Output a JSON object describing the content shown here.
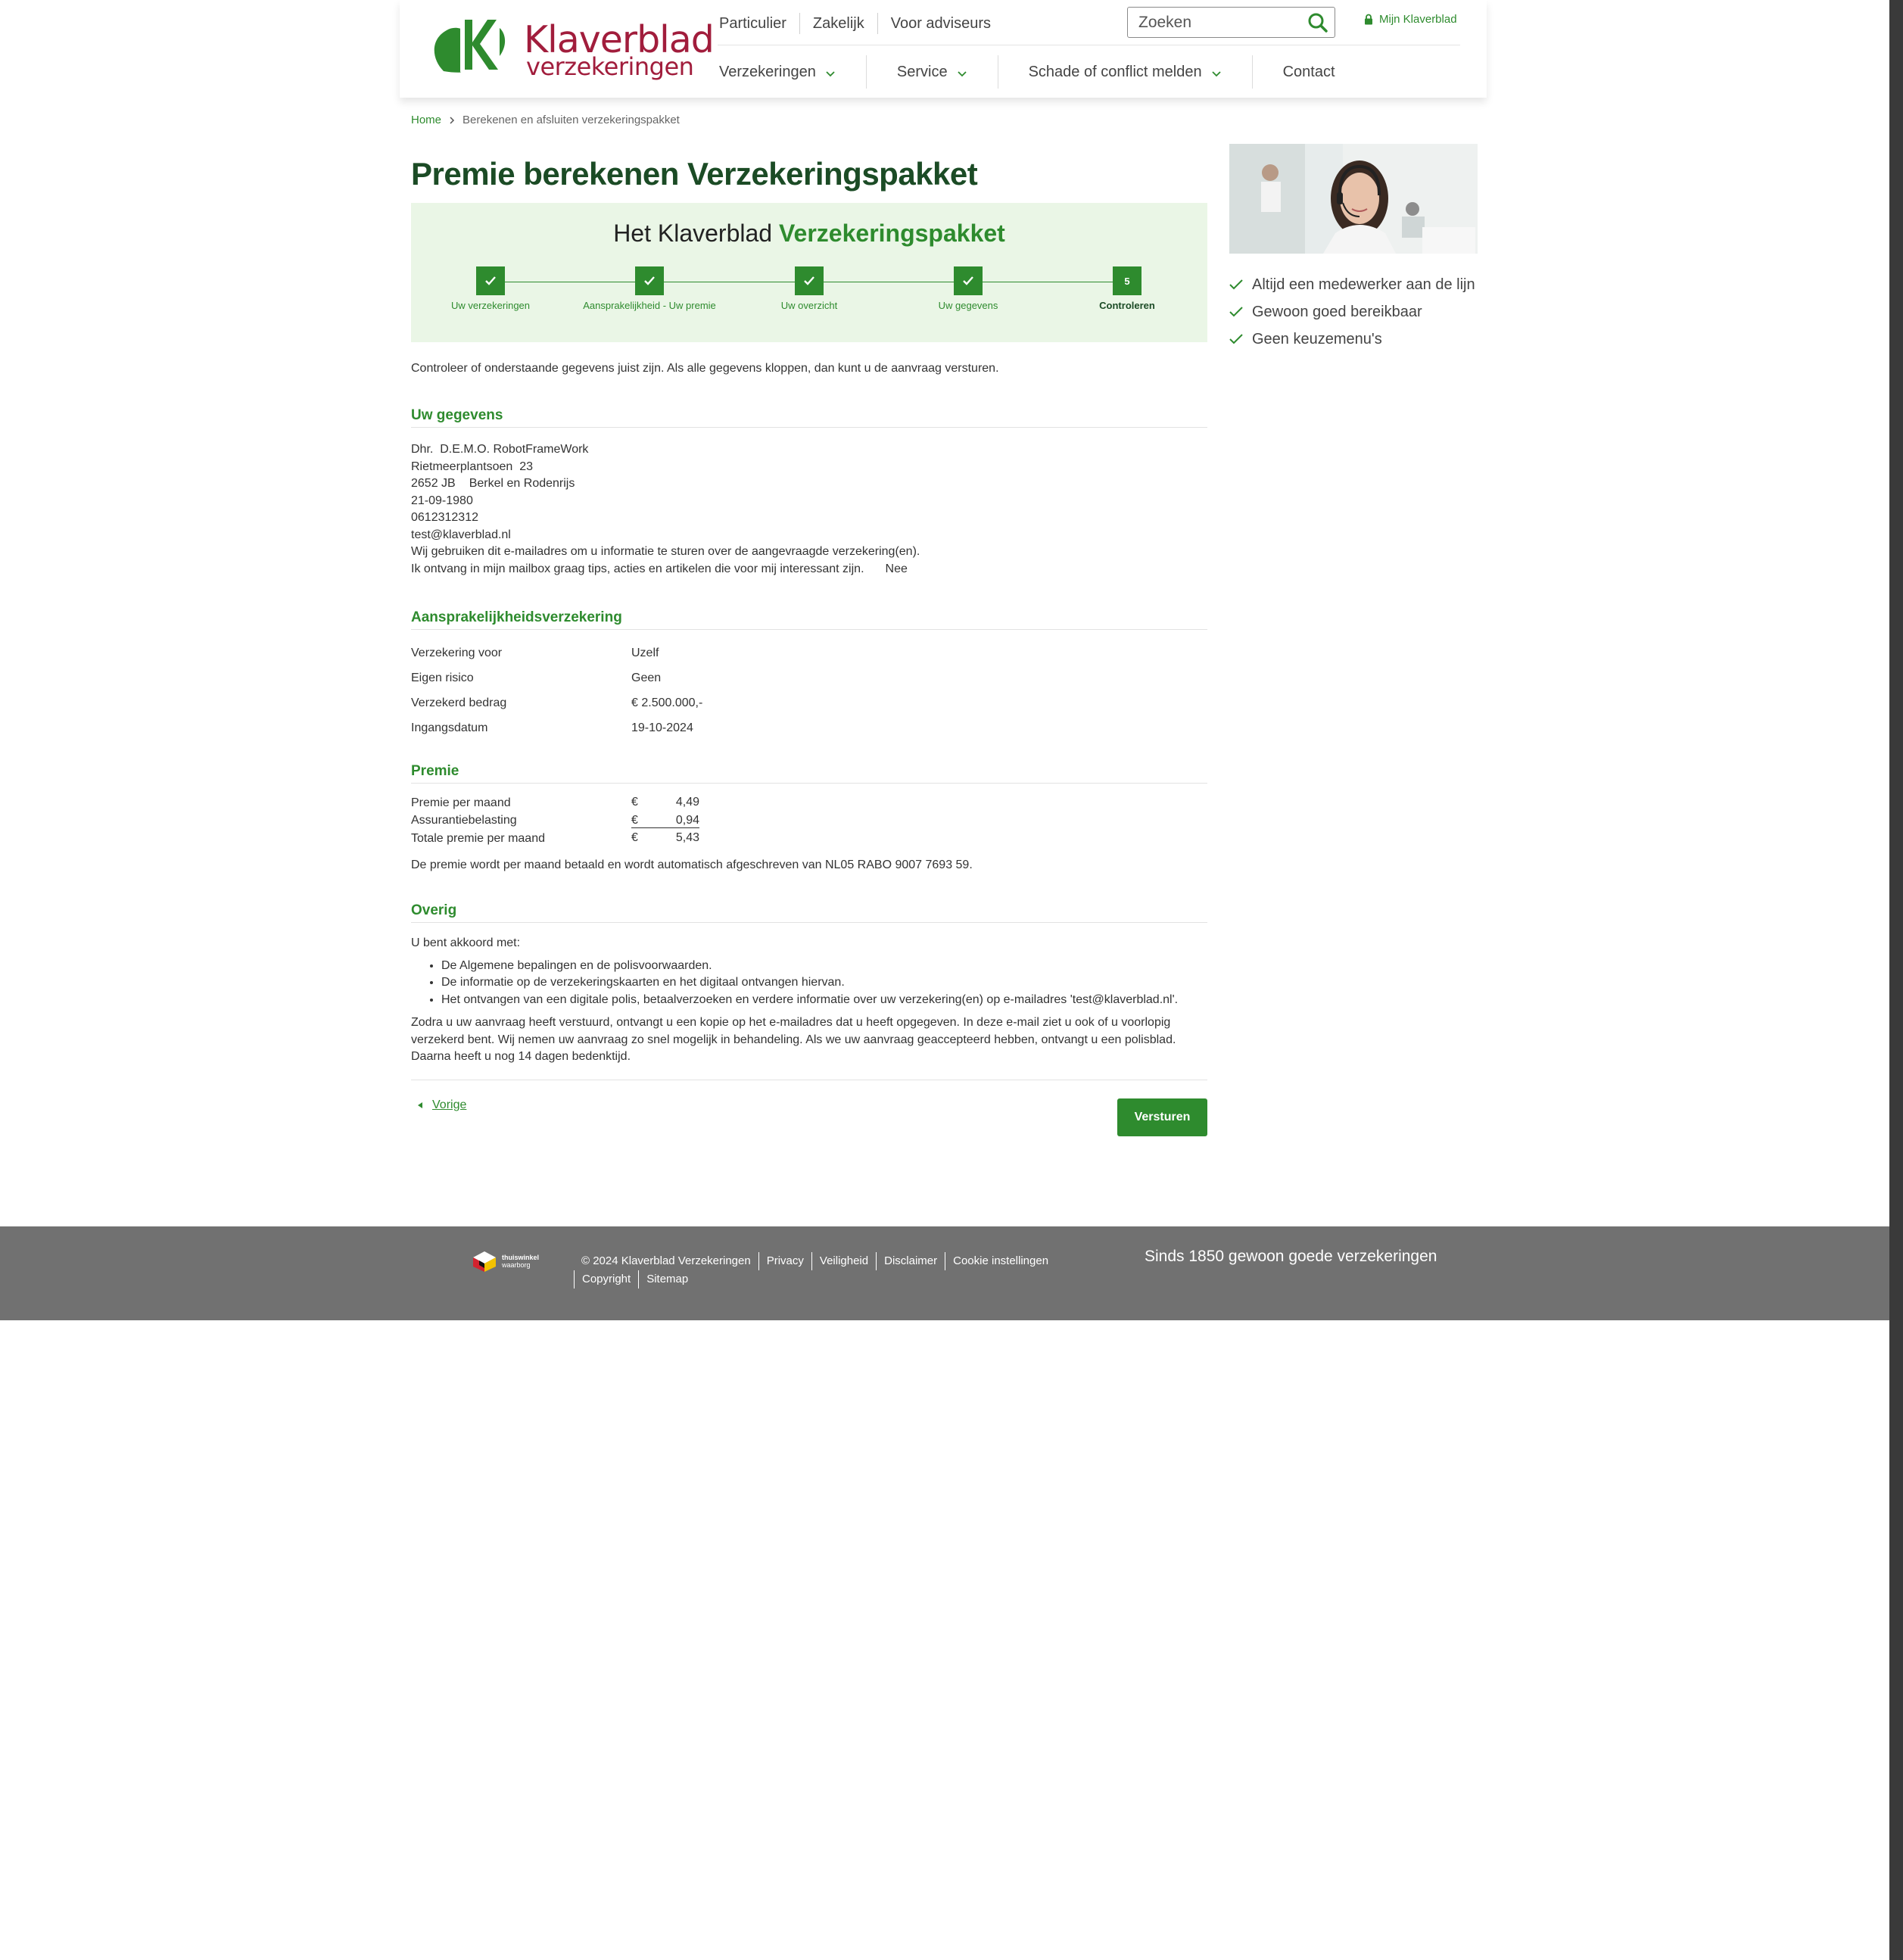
{
  "brand": {
    "name": "Klaverblad",
    "sub": "verzekeringen",
    "color_red": "#a11d3c",
    "color_green": "#2e8b2e"
  },
  "topnav": [
    "Particulier",
    "Zakelijk",
    "Voor adviseurs"
  ],
  "search": {
    "placeholder": "Zoeken"
  },
  "account_link": "Mijn Klaverblad",
  "mainnav": [
    "Verzekeringen",
    "Service",
    "Schade of conflict melden",
    "Contact"
  ],
  "breadcrumb": {
    "home": "Home",
    "current": "Berekenen en afsluiten verzekeringspakket"
  },
  "page_title": "Premie berekenen Verzekeringspakket",
  "steps": {
    "title_prefix": "Het Klaverblad",
    "title_highlight": "Verzekeringspakket",
    "items": [
      {
        "label": "Uw verzekeringen",
        "done": true
      },
      {
        "label": "Aansprakelijkheid - Uw premie",
        "done": true
      },
      {
        "label": "Uw overzicht",
        "done": true
      },
      {
        "label": "Uw gegevens",
        "done": true
      },
      {
        "label": "Controleren",
        "number": "5",
        "current": true
      }
    ]
  },
  "intro": "Controleer of onderstaande gegevens juist zijn. Als alle gegevens kloppen, dan kunt u de aanvraag versturen.",
  "gegevens": {
    "heading": "Uw gegevens",
    "salutation": "Dhr.",
    "name": "D.E.M.O. RobotFrameWork",
    "street": "Rietmeerplantsoen",
    "number": "23",
    "postcode": "2652 JB",
    "city": "Berkel en Rodenrijs",
    "birthdate": "21-09-1980",
    "phone": "0612312312",
    "email": "test@klaverblad.nl",
    "email_note": "Wij gebruiken dit e-mailadres om u informatie te sturen over de aangevraagde verzekering(en).",
    "newsletter_label": "Ik ontvang in mijn mailbox graag tips, acties en artikelen die voor mij interessant zijn.",
    "newsletter_value": "Nee"
  },
  "aansprakelijkheid": {
    "heading": "Aansprakelijkheidsverzekering",
    "rows": [
      {
        "label": "Verzekering voor",
        "value": "Uzelf"
      },
      {
        "label": "Eigen risico",
        "value": "Geen"
      },
      {
        "label": "Verzekerd bedrag",
        "value": "€  2.500.000,-"
      },
      {
        "label": "Ingangsdatum",
        "value": "19-10-2024"
      }
    ]
  },
  "premie": {
    "heading": "Premie",
    "currency": "€",
    "rows": [
      {
        "label": "Premie per maand",
        "amount": "4,49"
      },
      {
        "label": "Assurantiebelasting",
        "amount": "0,94"
      },
      {
        "label": "Totale premie per maand",
        "amount": "5,43"
      }
    ],
    "note": "De premie wordt per maand betaald en wordt automatisch afgeschreven van NL05 RABO 9007 7693 59."
  },
  "overig": {
    "heading": "Overig",
    "intro": "U bent akkoord met:",
    "items": [
      "De Algemene bepalingen en de polisvoorwaarden.",
      "De informatie op de verzekeringskaarten en het digitaal ontvangen hiervan.",
      "Het ontvangen van een digitale polis, betaalverzoeken en verdere informatie over uw verzekering(en) op e-mailadres 'test@klaverblad.nl'."
    ],
    "text": "Zodra u uw aanvraag heeft verstuurd, ontvangt u een kopie op het e-mailadres dat u heeft opgegeven. In deze e-mail ziet u ook of u voorlopig verzekerd bent. Wij nemen uw aanvraag zo snel mogelijk in behandeling. Als we uw aanvraag geaccepteerd hebben, ontvangt u een polisblad. Daarna heeft u nog 14 dagen bedenktijd."
  },
  "actions": {
    "previous": "Vorige",
    "submit": "Versturen"
  },
  "sidebar": {
    "usps": [
      "Altijd een medewerker aan de lijn",
      "Gewoon goed bereikbaar",
      "Geen keuzemenu's"
    ]
  },
  "footer": {
    "badge_line1": "thuiswinkel",
    "badge_line2": "waarborg",
    "copyright": "© 2024 Klaverblad Verzekeringen",
    "links": [
      "Privacy",
      "Veiligheid",
      "Disclaimer",
      "Cookie instellingen",
      "Copyright",
      "Sitemap"
    ],
    "slogan": "Sinds 1850 gewoon goede verzekeringen"
  }
}
